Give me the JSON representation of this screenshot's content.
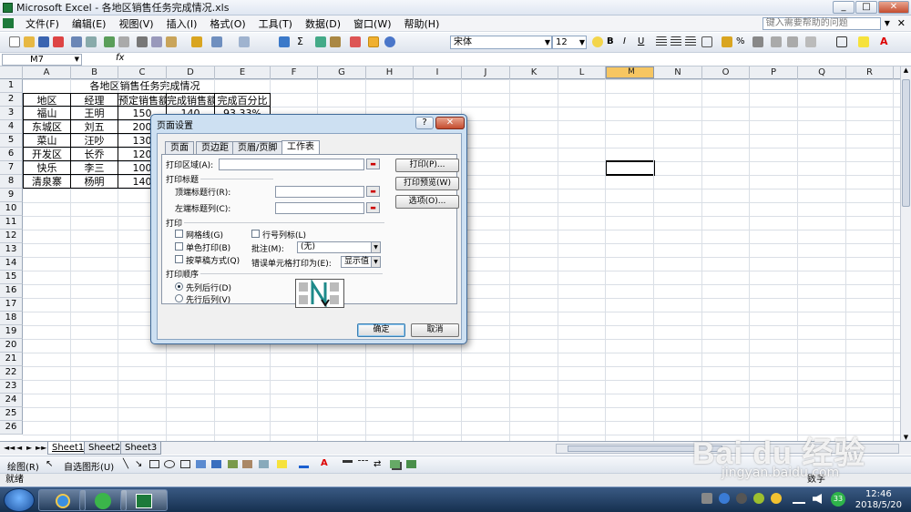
{
  "window": {
    "title": "Microsoft Excel - 各地区销售任务完成情况.xls",
    "min": "_",
    "max": "□",
    "close": "✕"
  },
  "menu": {
    "items": [
      "文件(F)",
      "编辑(E)",
      "视图(V)",
      "插入(I)",
      "格式(O)",
      "工具(T)",
      "数据(D)",
      "窗口(W)",
      "帮助(H)"
    ],
    "help_placeholder": "键入需要帮助的问题",
    "help_arrow": "▼",
    "close_doc": "✕"
  },
  "format_toolbar": {
    "font": "宋体",
    "size": "12",
    "bold": "B",
    "italic": "I",
    "underline": "U",
    "percent": "%"
  },
  "formula_bar": {
    "name_box": "M7",
    "fx": "fx",
    "content": ""
  },
  "columns": [
    "A",
    "B",
    "C",
    "D",
    "E",
    "F",
    "G",
    "H",
    "I",
    "J",
    "K",
    "L",
    "M",
    "N",
    "O",
    "P",
    "Q",
    "R"
  ],
  "selected_column": "M",
  "rows": [
    "1",
    "2",
    "3",
    "4",
    "5",
    "6",
    "7",
    "8",
    "9",
    "10",
    "11",
    "12",
    "13",
    "14",
    "15",
    "16",
    "17",
    "18",
    "19",
    "20",
    "21",
    "22",
    "23",
    "24",
    "25",
    "26"
  ],
  "sheet": {
    "title": "各地区销售任务完成情况",
    "headers": [
      "地区",
      "经理",
      "预定销售额",
      "完成销售额",
      "完成百分比"
    ],
    "rows": [
      [
        "福山",
        "王明",
        "150",
        "140",
        "93.33%"
      ],
      [
        "东城区",
        "刘五",
        "200",
        "",
        ""
      ],
      [
        "菜山",
        "汪吵",
        "130",
        "",
        ""
      ],
      [
        "开发区",
        "长乔",
        "120",
        "",
        ""
      ],
      [
        "快乐",
        "李三",
        "100",
        "",
        ""
      ],
      [
        "清泉寨",
        "杨明",
        "140",
        "",
        ""
      ]
    ]
  },
  "tabs": {
    "sheets": [
      "Sheet1",
      "Sheet2",
      "Sheet3"
    ],
    "active": "Sheet1",
    "nav": [
      "◄◄",
      "◄",
      "►",
      "►►"
    ]
  },
  "draw_toolbar": {
    "draw": "绘图(R)",
    "autoshapes": "自选图形(U)"
  },
  "status": {
    "ready": "就绪",
    "num": "数字"
  },
  "taskbar": {
    "time": "12:46",
    "date": "2018/5/20",
    "badge": "33"
  },
  "dialog": {
    "title": "页面设置",
    "help": "?",
    "close": "✕",
    "tabs": [
      "页面",
      "页边距",
      "页眉/页脚",
      "工作表"
    ],
    "active_tab": "工作表",
    "print_area": "打印区域(A):",
    "print_titles": "打印标题",
    "rows_repeat": "顶端标题行(R):",
    "cols_repeat": "左端标题列(C):",
    "print_section": "打印",
    "gridlines": "网格线(G)",
    "mono": "单色打印(B)",
    "draft": "按草稿方式(Q)",
    "row_col_headings": "行号列标(L)",
    "comments_label": "批注(M):",
    "comments_value": "(无)",
    "errors_label": "错误单元格打印为(E):",
    "errors_value": "显示值",
    "order_section": "打印顺序",
    "down_then_over": "先列后行(D)",
    "over_then_down": "先行后列(V)",
    "btn_print": "打印(P)...",
    "btn_preview": "打印预览(W)",
    "btn_options": "选项(O)...",
    "btn_ok": "确定",
    "btn_cancel": "取消"
  },
  "watermark": {
    "brand": "Bai du 经验",
    "url": "jingyan.baidu.com"
  }
}
